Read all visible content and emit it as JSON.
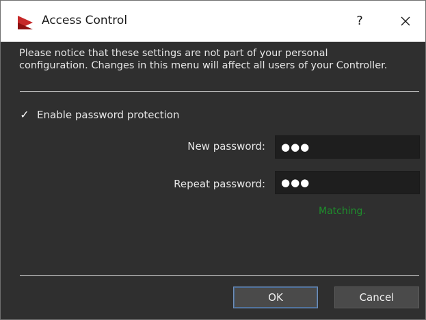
{
  "window": {
    "title": "Access Control",
    "help_label": "?",
    "close_icon": "close-icon",
    "app_icon": "play-triangle-icon"
  },
  "notice": {
    "line1": "Please notice that these settings are not part of your personal",
    "line2": "configuration. Changes in this menu will affect all users of your Controller."
  },
  "password_protection": {
    "checkbox_checked": true,
    "checkbox_glyph": "✓",
    "label": "Enable password protection"
  },
  "new_password": {
    "label": "New password:",
    "value": "●●●"
  },
  "repeat_password": {
    "label": "Repeat password:",
    "value": "●●●"
  },
  "status": {
    "text": "Matching.",
    "color": "#1e8f2c"
  },
  "buttons": {
    "ok": "OK",
    "cancel": "Cancel"
  }
}
